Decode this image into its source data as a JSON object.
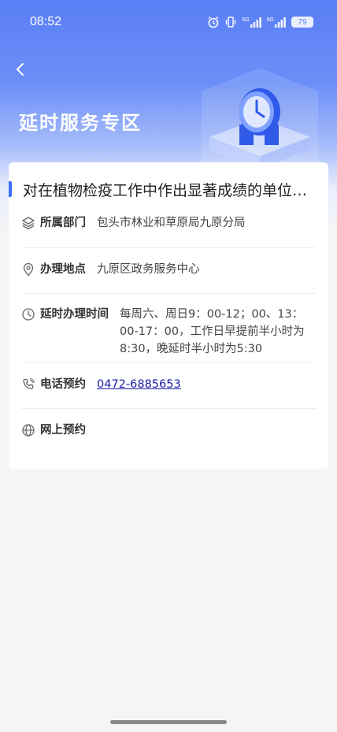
{
  "status_bar": {
    "time": "08:52",
    "network_label_1": "5G",
    "network_label_2": "5G",
    "battery": "79"
  },
  "header": {
    "back_icon": "chevron-left-icon",
    "title": "延时服务专区"
  },
  "card": {
    "title": "对在植物检疫工作中作出显著成绩的单位和个人的表彰",
    "rows": [
      {
        "icon": "layers-icon",
        "label": "所属部门",
        "value": "包头市林业和草原局九原分局"
      },
      {
        "icon": "location-pin-icon",
        "label": "办理地点",
        "value": "九原区政务服务中心"
      },
      {
        "icon": "clock-icon",
        "label": "延时办理时间",
        "value": "每周六、周日9：00-12；00、13：00-17：00，工作日早提前半小时为8:30，晚延时半小时为5:30"
      },
      {
        "icon": "phone-icon",
        "label": "电话预约",
        "value": "0472-6885653"
      },
      {
        "icon": "globe-icon",
        "label": "网上预约",
        "value": ""
      }
    ]
  },
  "colors": {
    "hero_blue": "#5a7ff5",
    "accent_blue": "#3a6ff6",
    "phone_link": "#1a1aa8"
  }
}
